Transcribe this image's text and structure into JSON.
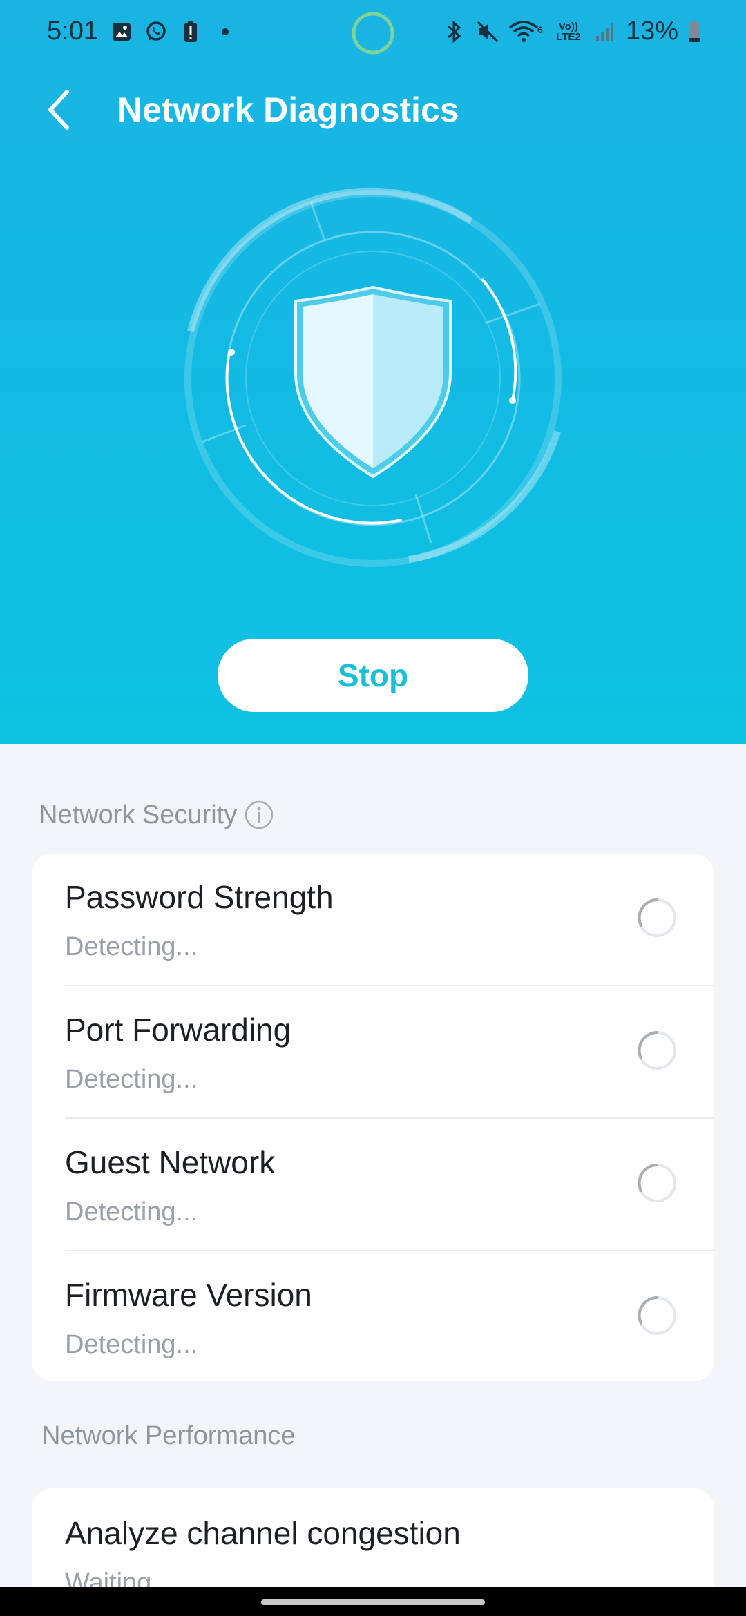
{
  "status_bar": {
    "time": "5:01",
    "battery_percent": "13%",
    "network_label_top": "Vo))",
    "network_label_bottom": "LTE2",
    "wifi_label": "6",
    "left_icons": [
      "gallery-icon",
      "whatsapp-icon",
      "battery-alert-icon",
      "dot-icon"
    ],
    "right_icons": [
      "bluetooth-icon",
      "mute-icon",
      "wifi-icon",
      "volte-icon",
      "signal-icon",
      "battery-icon"
    ]
  },
  "header": {
    "title": "Network Diagnostics"
  },
  "actions": {
    "stop_label": "Stop"
  },
  "colors": {
    "brand_blue": "#12bbe3",
    "button_text": "#1bbfd6",
    "section_title": "#8e959c"
  },
  "security": {
    "title": "Network Security",
    "items": [
      {
        "title": "Password Strength",
        "status": "Detecting..."
      },
      {
        "title": "Port Forwarding",
        "status": "Detecting..."
      },
      {
        "title": "Guest Network",
        "status": "Detecting..."
      },
      {
        "title": "Firmware Version",
        "status": "Detecting..."
      }
    ]
  },
  "performance": {
    "title": "Network Performance",
    "items": [
      {
        "title": "Analyze channel congestion",
        "status": "Waiting..."
      }
    ]
  }
}
